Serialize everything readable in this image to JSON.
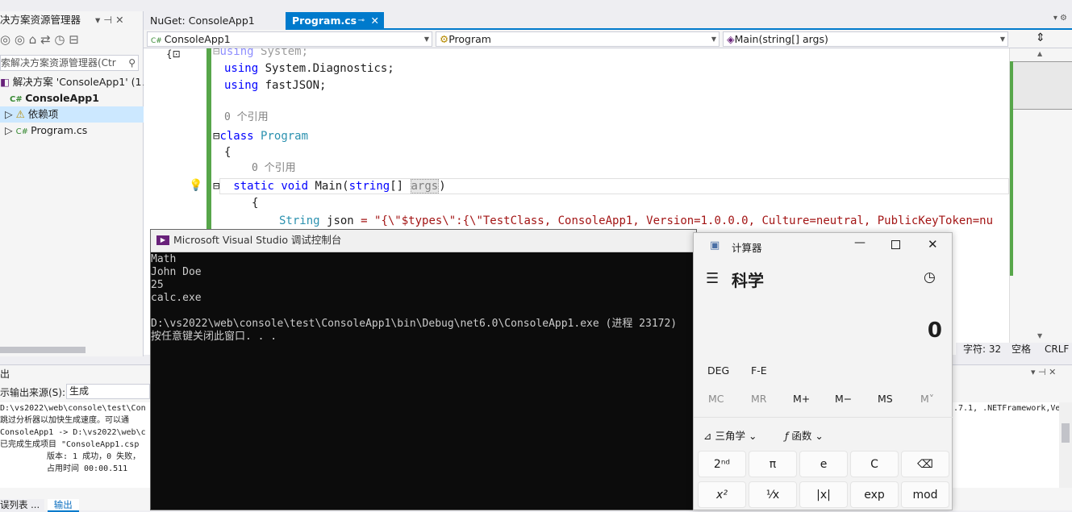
{
  "solution_explorer": {
    "title": "决方案资源管理器",
    "pin": "▾ ⊣ ✕",
    "search_placeholder": "索解决方案资源管理器(Ctr",
    "solution": "解决方案 'ConsoleApp1' (1 ⁄",
    "project": "ConsoleApp1",
    "deps": "依赖项",
    "file": "Program.cs"
  },
  "tabs": [
    {
      "label": "NuGet: ConsoleApp1"
    },
    {
      "label": "Program.cs"
    }
  ],
  "nav": {
    "project": "ConsoleApp1",
    "class": "Program",
    "member": "Main(string[] args)"
  },
  "code": {
    "using1": "using",
    "ns1": "System;",
    "using2": "using",
    "ns2": "System.Diagnostics;",
    "using3": "using",
    "ns3": "fastJSON;",
    "ref1": "0 个引用",
    "class_kw": "class",
    "class_name": "Program",
    "brace1": "{",
    "ref2": "0 个引用",
    "static": "static",
    "void": "void",
    "main": "Main(",
    "string": "string",
    "args_rest": "[] ",
    "args": "args",
    "paren": ")",
    "brace2": "{",
    "string_type": "String",
    "json_var": "json",
    "json_rest": " = \"{\\\"$types\\\":{\\\"TestClass, ConsoleApp1, Version=1.0.0.0, Culture=neutral, PublicKeyToken=nu"
  },
  "status": {
    "chars": "字符: 32",
    "space": "空格",
    "eol": "CRLF"
  },
  "output": {
    "title": "出",
    "source_label": "示输出来源(S):",
    "source_value": "生成",
    "lines": [
      "D:\\vs2022\\web\\console\\test\\Con",
      "跳过分析器以加快生成速度。可以通",
      "ConsoleApp1 -> D:\\vs2022\\web\\c",
      "已完成生成项目 \"ConsoleApp1.csp",
      "版本: 1 成功，0 失败，",
      "占用时间 00:00.511"
    ],
    "right_text": ".7.1, .NETFramework,Ve",
    "tabs": [
      "误列表 ...",
      "输出"
    ]
  },
  "console": {
    "title": "Microsoft Visual Studio 调试控制台",
    "lines": [
      "Math",
      "John Doe",
      "25",
      "calc.exe",
      "",
      "D:\\vs2022\\web\\console\\test\\ConsoleApp1\\bin\\Debug\\net6.0\\ConsoleApp1.exe (进程 23172)",
      "按任意键关闭此窗口. . ."
    ]
  },
  "calculator": {
    "title": "计算器",
    "mode": "科学",
    "display": "0",
    "deg": "DEG",
    "fe": "F-E",
    "memory": [
      "MC",
      "MR",
      "M+",
      "M−",
      "MS",
      "M˅"
    ],
    "trig": "三角学",
    "func": "函数",
    "keys_row1": [
      "2ⁿᵈ",
      "π",
      "e",
      "C",
      "⌫"
    ],
    "keys_row2": [
      "x²",
      "¹⁄x",
      "|x|",
      "exp",
      "mod"
    ]
  }
}
